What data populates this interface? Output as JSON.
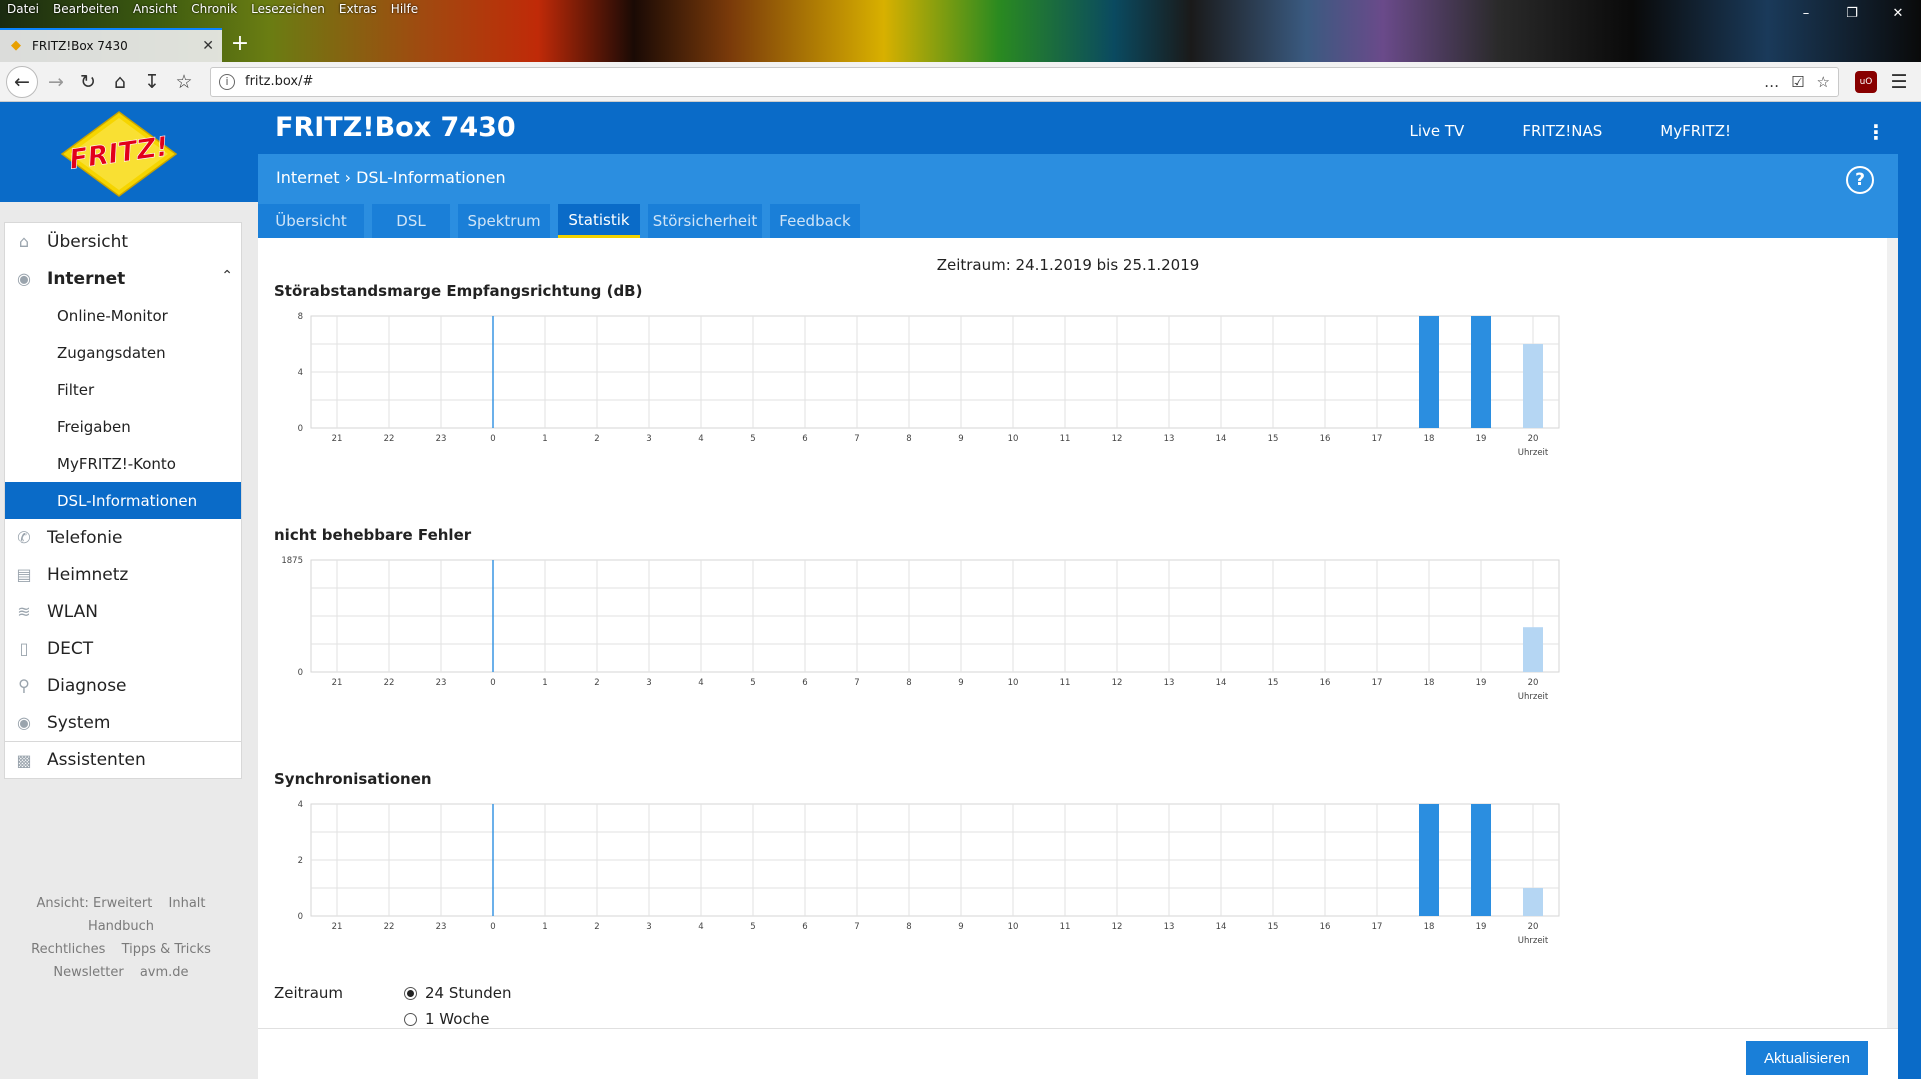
{
  "browser": {
    "menu": [
      "Datei",
      "Bearbeiten",
      "Ansicht",
      "Chronik",
      "Lesezeichen",
      "Extras",
      "Hilfe"
    ],
    "tab_title": "FRITZ!Box 7430",
    "url": "fritz.box/#"
  },
  "header": {
    "title": "FRITZ!Box 7430",
    "nav": [
      "Live TV",
      "FRITZ!NAS",
      "MyFRITZ!"
    ],
    "logo_text": "FRITZ!"
  },
  "breadcrumb": {
    "parent": "Internet",
    "current": "DSL-Informationen"
  },
  "help_label": "?",
  "tabs": [
    {
      "label": "Übersicht",
      "active": false
    },
    {
      "label": "DSL",
      "active": false
    },
    {
      "label": "Spektrum",
      "active": false
    },
    {
      "label": "Statistik",
      "active": true
    },
    {
      "label": "Störsicherheit",
      "active": false
    },
    {
      "label": "Feedback",
      "active": false
    }
  ],
  "sidebar": {
    "items": [
      {
        "label": "Übersicht",
        "icon": "home-icon"
      },
      {
        "label": "Internet",
        "icon": "globe-icon",
        "expanded": true,
        "children": [
          {
            "label": "Online-Monitor"
          },
          {
            "label": "Zugangsdaten"
          },
          {
            "label": "Filter"
          },
          {
            "label": "Freigaben"
          },
          {
            "label": "MyFRITZ!-Konto"
          },
          {
            "label": "DSL-Informationen",
            "active": true
          }
        ]
      },
      {
        "label": "Telefonie",
        "icon": "phone-icon"
      },
      {
        "label": "Heimnetz",
        "icon": "network-icon"
      },
      {
        "label": "WLAN",
        "icon": "wifi-icon"
      },
      {
        "label": "DECT",
        "icon": "dect-icon"
      },
      {
        "label": "Diagnose",
        "icon": "diagnose-icon"
      },
      {
        "label": "System",
        "icon": "system-icon"
      },
      {
        "label": "Assistenten",
        "icon": "wizard-icon"
      }
    ],
    "footer": [
      [
        "Ansicht: Erweitert",
        "Inhalt",
        "Handbuch"
      ],
      [
        "Rechtliches",
        "Tipps & Tricks"
      ],
      [
        "Newsletter",
        "avm.de"
      ]
    ]
  },
  "content": {
    "period": "Zeitraum: 24.1.2019 bis 25.1.2019",
    "zeitraum_label": "Zeitraum",
    "options": [
      {
        "label": "24 Stunden",
        "selected": true
      },
      {
        "label": "1 Woche",
        "selected": false
      }
    ],
    "refresh_button": "Aktualisieren"
  },
  "colors": {
    "brand_blue": "#0a6bc8",
    "bar_dark": "#2b8ee0",
    "bar_light": "#b5d6f3",
    "active_tab_underline": "#f3d200"
  },
  "chart_data": [
    {
      "type": "bar",
      "title": "Störabstandsmarge Empfangsrichtung (dB)",
      "x_ticks": [
        "21",
        "22",
        "23",
        "0",
        "1",
        "2",
        "3",
        "4",
        "5",
        "6",
        "7",
        "8",
        "9",
        "10",
        "11",
        "12",
        "13",
        "14",
        "15",
        "16",
        "17",
        "18",
        "19",
        "20"
      ],
      "xlabel": "Uhrzeit",
      "y_ticks": [
        "0",
        "4",
        "8"
      ],
      "ylim": [
        0,
        8
      ],
      "bars": [
        {
          "x": "18",
          "value": 8,
          "style": "dark"
        },
        {
          "x": "19",
          "value": 8,
          "style": "dark"
        },
        {
          "x": "20",
          "value": 6,
          "style": "light"
        }
      ],
      "marker_at": "0"
    },
    {
      "type": "bar",
      "title": "nicht behebbare Fehler",
      "x_ticks": [
        "21",
        "22",
        "23",
        "0",
        "1",
        "2",
        "3",
        "4",
        "5",
        "6",
        "7",
        "8",
        "9",
        "10",
        "11",
        "12",
        "13",
        "14",
        "15",
        "16",
        "17",
        "18",
        "19",
        "20"
      ],
      "xlabel": "Uhrzeit",
      "y_ticks": [
        "0",
        "1875"
      ],
      "ylim": [
        0,
        1875
      ],
      "bars": [
        {
          "x": "20",
          "value": 750,
          "style": "light"
        }
      ],
      "marker_at": "0"
    },
    {
      "type": "bar",
      "title": "Synchronisationen",
      "x_ticks": [
        "21",
        "22",
        "23",
        "0",
        "1",
        "2",
        "3",
        "4",
        "5",
        "6",
        "7",
        "8",
        "9",
        "10",
        "11",
        "12",
        "13",
        "14",
        "15",
        "16",
        "17",
        "18",
        "19",
        "20"
      ],
      "xlabel": "Uhrzeit",
      "y_ticks": [
        "0",
        "2",
        "4"
      ],
      "ylim": [
        0,
        4
      ],
      "bars": [
        {
          "x": "18",
          "value": 4,
          "style": "dark"
        },
        {
          "x": "19",
          "value": 4,
          "style": "dark"
        },
        {
          "x": "20",
          "value": 1,
          "style": "light"
        }
      ],
      "marker_at": "0"
    }
  ]
}
